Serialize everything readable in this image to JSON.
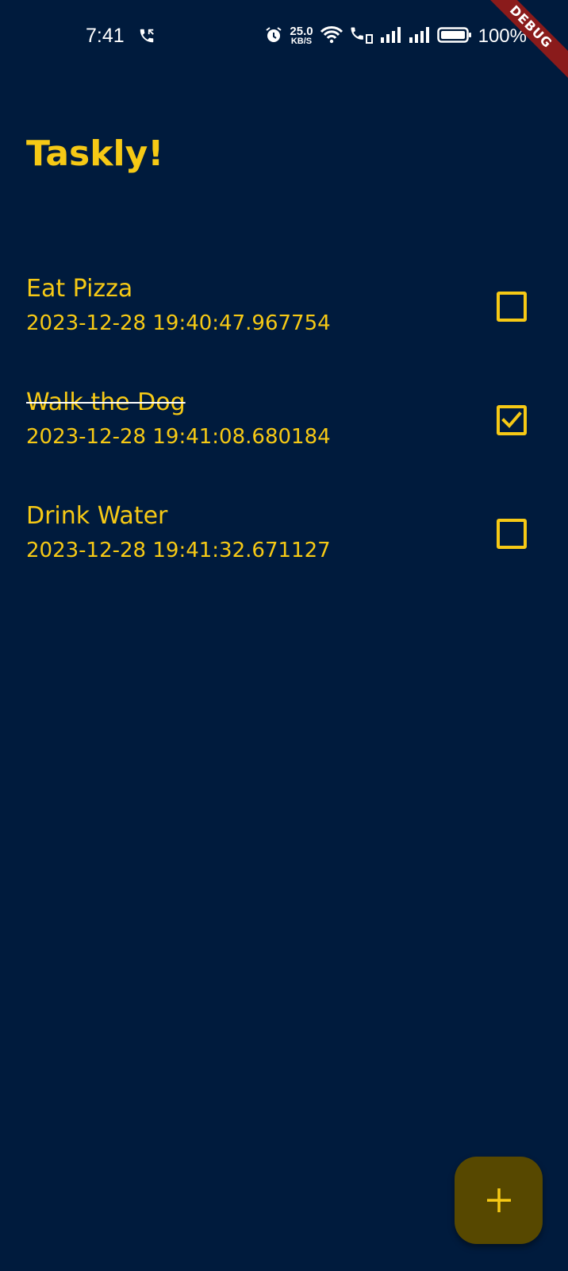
{
  "status_bar": {
    "time": "7:41",
    "net_speed_value": "25.0",
    "net_speed_unit": "KB/S",
    "battery_percent": "100%",
    "icons": [
      "call-icon",
      "alarm-icon",
      "wifi-icon",
      "wifi-call-icon",
      "signal-icon",
      "signal-icon",
      "battery-icon"
    ]
  },
  "debug_banner": "DEBUG",
  "app": {
    "title": "Taskly!"
  },
  "tasks": [
    {
      "title": "Eat Pizza",
      "date": "2023-12-28 19:40:47.967754",
      "done": false
    },
    {
      "title": "Walk the Dog",
      "date": "2023-12-28 19:41:08.680184",
      "done": true
    },
    {
      "title": "Drink Water",
      "date": "2023-12-28 19:41:32.671127",
      "done": false
    }
  ],
  "fab": {
    "icon": "plus-icon"
  },
  "colors": {
    "background": "#001b3d",
    "accent": "#f6c915",
    "fab": "#574800",
    "debug_ribbon": "#8a1b1b"
  }
}
